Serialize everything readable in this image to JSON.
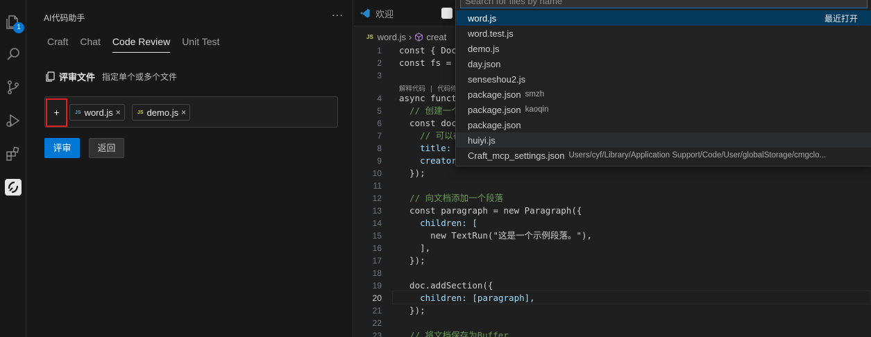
{
  "activity_bar": {
    "badge_count": "1",
    "icons": [
      "explorer-icon",
      "search-icon",
      "source-control-icon",
      "run-debug-icon",
      "extensions-icon",
      "ai-assistant-icon"
    ]
  },
  "panel": {
    "title": "AI代码助手",
    "more": "···",
    "tabs": [
      "Craft",
      "Chat",
      "Code Review",
      "Unit Test"
    ],
    "active_tab": "Code Review",
    "section_title": "评审文件",
    "section_desc": "指定单个或多个文件",
    "add_label": "+",
    "chips": [
      {
        "icon": "JS",
        "name": "word.js",
        "close": "×"
      },
      {
        "icon": "JS",
        "name": "demo.js",
        "close": "×"
      }
    ],
    "review_button": "评审",
    "back_button": "返回"
  },
  "editor": {
    "tabs": [
      {
        "label": "欢迎"
      }
    ],
    "breadcrumb": {
      "file": "word.js",
      "sep": "›",
      "symbol": "creat"
    },
    "current_line": "20",
    "code_lines": [
      {
        "n": "1",
        "text": "const { Doc"
      },
      {
        "n": "2",
        "text": "const fs ="
      },
      {
        "n": "3",
        "text": ""
      },
      {
        "n": "4",
        "text": "async funct"
      },
      {
        "n": "5",
        "text": "  // 创建一个"
      },
      {
        "n": "6",
        "text": "  const doc"
      },
      {
        "n": "7",
        "text": "    // 可以在"
      },
      {
        "n": "8",
        "text": "    title:"
      },
      {
        "n": "9",
        "text": "    creator"
      },
      {
        "n": "10",
        "text": "  });"
      },
      {
        "n": "11",
        "text": ""
      },
      {
        "n": "12",
        "text": "  // 向文档添加一个段落"
      },
      {
        "n": "13",
        "text": "  const paragraph = new Paragraph({"
      },
      {
        "n": "14",
        "text": "    children: ["
      },
      {
        "n": "15",
        "text": "      new TextRun(\"这是一个示例段落。\"),"
      },
      {
        "n": "16",
        "text": "    ],"
      },
      {
        "n": "17",
        "text": "  });"
      },
      {
        "n": "18",
        "text": ""
      },
      {
        "n": "19",
        "text": "  doc.addSection({"
      },
      {
        "n": "20",
        "text": "    children: [paragraph],"
      },
      {
        "n": "21",
        "text": "  });"
      },
      {
        "n": "22",
        "text": ""
      },
      {
        "n": "23",
        "text": "  // 将文档保存为Buffer"
      }
    ],
    "codelens": "解释代码 | 代码修"
  },
  "quickpick": {
    "placeholder": "Search for files by name",
    "items": [
      {
        "name": "word.js",
        "desc": "",
        "right": "最近打开",
        "state": "selected"
      },
      {
        "name": "word.test.js",
        "desc": "",
        "right": "",
        "state": ""
      },
      {
        "name": "demo.js",
        "desc": "",
        "right": "",
        "state": ""
      },
      {
        "name": "day.json",
        "desc": "",
        "right": "",
        "state": ""
      },
      {
        "name": "senseshou2.js",
        "desc": "",
        "right": "",
        "state": ""
      },
      {
        "name": "package.json",
        "desc": "smzh",
        "right": "",
        "state": ""
      },
      {
        "name": "package.json",
        "desc": "kaoqin",
        "right": "",
        "state": ""
      },
      {
        "name": "package.json",
        "desc": "",
        "right": "",
        "state": ""
      },
      {
        "name": "huiyi.js",
        "desc": "",
        "right": "",
        "state": "hover"
      },
      {
        "name": "Craft_mcp_settings.json",
        "desc": "Users/cyf/Library/Application Support/Code/User/globalStorage/cmgclo...",
        "right": "",
        "state": ""
      }
    ]
  },
  "colors": {
    "accent": "#0078d4",
    "highlight_border": "#e02020",
    "selection": "#04395e"
  }
}
